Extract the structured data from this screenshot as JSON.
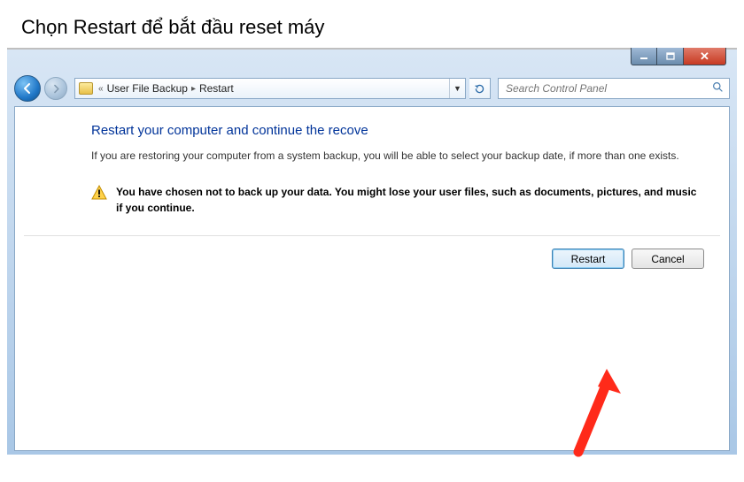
{
  "caption": "Chọn Restart để bắt đầu reset máy",
  "breadcrumb": {
    "item1": "User File Backup",
    "item2": "Restart"
  },
  "search": {
    "placeholder": "Search Control Panel"
  },
  "page": {
    "heading": "Restart your computer and continue the recove",
    "paragraph": "If you are restoring your computer from a system backup, you will be able to select your backup date, if more than one exists.",
    "warning": "You have chosen not to back up your data. You might lose your user files, such as documents, pictures, and music if you continue."
  },
  "buttons": {
    "restart": "Restart",
    "cancel": "Cancel"
  }
}
